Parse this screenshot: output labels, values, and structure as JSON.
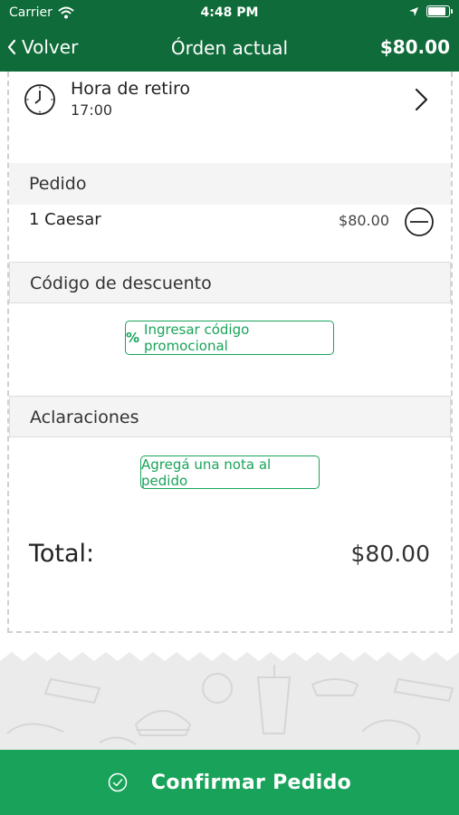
{
  "status_bar": {
    "carrier": "Carrier",
    "time": "4:48 PM"
  },
  "nav": {
    "back_label": "Volver",
    "title": "Órden actual",
    "total": "$80.00"
  },
  "pickup": {
    "label": "Hora de retiro",
    "value": "17:00"
  },
  "order": {
    "section_title": "Pedido",
    "items": [
      {
        "name": "1 Caesar",
        "price": "$80.00"
      }
    ]
  },
  "discount": {
    "section_title": "Código de descuento",
    "button_icon": "%",
    "button_label": "Ingresar código promocional"
  },
  "notes": {
    "section_title": "Aclaraciones",
    "button_label": "Agregá una nota al pedido"
  },
  "summary": {
    "total_label": "Total:",
    "total_value": "$80.00"
  },
  "confirm": {
    "label": "Confirmar Pedido"
  },
  "colors": {
    "header": "#0f6b39",
    "accent": "#19a35a",
    "section_bg": "#f4f4f4"
  },
  "icons": [
    "wifi-icon",
    "location-arrow-icon",
    "battery-icon",
    "back-chevron-icon",
    "clock-icon",
    "chevron-right-icon",
    "minus-circle-icon",
    "check-circle-icon"
  ]
}
